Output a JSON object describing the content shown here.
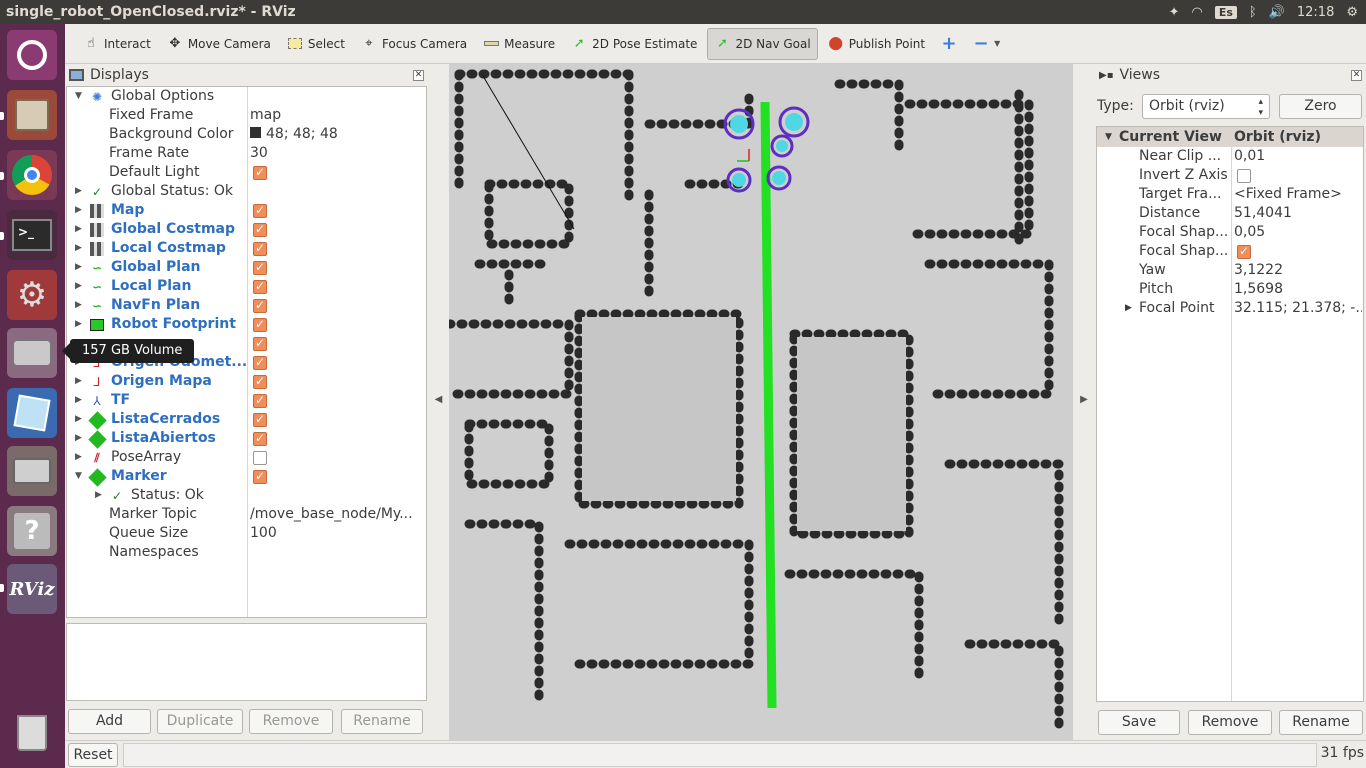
{
  "window": {
    "title": "single_robot_OpenClosed.rviz* - RViz"
  },
  "tray": {
    "lang": "Es",
    "time": "12:18"
  },
  "tooltip": "157 GB Volume",
  "toolbar": {
    "interact": "Interact",
    "move_camera": "Move Camera",
    "select": "Select",
    "focus_camera": "Focus Camera",
    "measure": "Measure",
    "pose_estimate": "2D Pose Estimate",
    "nav_goal": "2D Nav Goal",
    "publish_point": "Publish Point"
  },
  "displays": {
    "title": "Displays",
    "rows": [
      {
        "label": "Global Options"
      },
      {
        "label": "Fixed Frame",
        "value": "map"
      },
      {
        "label": "Background Color",
        "value": "48; 48; 48"
      },
      {
        "label": "Frame Rate",
        "value": "30"
      },
      {
        "label": "Default Light"
      },
      {
        "label": "Global Status: Ok"
      },
      {
        "label": "Map"
      },
      {
        "label": "Global Costmap"
      },
      {
        "label": "Local Costmap"
      },
      {
        "label": "Global Plan"
      },
      {
        "label": "Local Plan"
      },
      {
        "label": "NavFn Plan"
      },
      {
        "label": "Robot Footprint"
      },
      {
        "label": ""
      },
      {
        "label": "Origen Odomet..."
      },
      {
        "label": "Origen Mapa"
      },
      {
        "label": "TF"
      },
      {
        "label": "ListaCerrados"
      },
      {
        "label": "ListaAbiertos"
      },
      {
        "label": "PoseArray"
      },
      {
        "label": "Marker"
      },
      {
        "label": "Status: Ok"
      },
      {
        "label": "Marker Topic",
        "value": "/move_base_node/My..."
      },
      {
        "label": "Queue Size",
        "value": "100"
      },
      {
        "label": "Namespaces"
      }
    ],
    "buttons": {
      "add": "Add",
      "duplicate": "Duplicate",
      "remove": "Remove",
      "rename": "Rename"
    }
  },
  "views": {
    "title": "Views",
    "type_label": "Type:",
    "type_value": "Orbit (rviz)",
    "zero": "Zero",
    "header": {
      "name": "Current View",
      "value": "Orbit (rviz)"
    },
    "rows": [
      {
        "label": "Near Clip ...",
        "value": "0,01"
      },
      {
        "label": "Invert Z Axis",
        "value": ""
      },
      {
        "label": "Target Fra...",
        "value": "<Fixed Frame>"
      },
      {
        "label": "Distance",
        "value": "51,4041"
      },
      {
        "label": "Focal Shap...",
        "value": "0,05"
      },
      {
        "label": "Focal Shap...",
        "value": ""
      },
      {
        "label": "Yaw",
        "value": "3,1222"
      },
      {
        "label": "Pitch",
        "value": "1,5698"
      },
      {
        "label": "Focal Point",
        "value": "32.115; 21.378; -..."
      }
    ],
    "buttons": {
      "save": "Save",
      "remove": "Remove",
      "rename": "Rename"
    }
  },
  "status": {
    "reset": "Reset",
    "fps": "31 fps"
  }
}
